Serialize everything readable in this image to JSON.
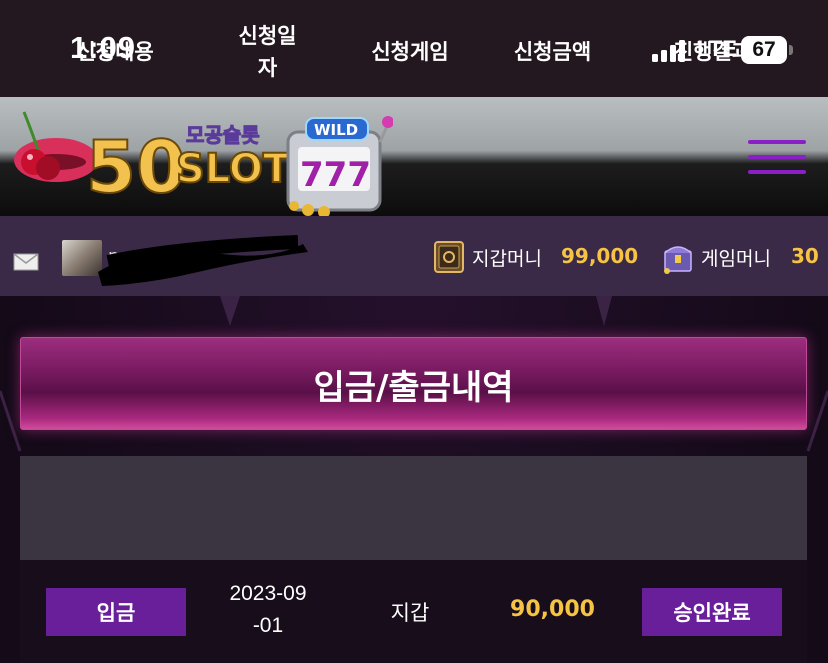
{
  "status_bar": {
    "time": "1:09",
    "network": "LTE",
    "battery": "67"
  },
  "header": {
    "logo_text_top": "모공슬롯",
    "logo_number": "50",
    "logo_word": "SLOT",
    "logo_badge": "WILD",
    "logo_reels": "777"
  },
  "user_bar": {
    "username": "n",
    "wallet_label": "지갑머니",
    "wallet_value": "99,000",
    "game_label": "게임머니",
    "game_value": "30"
  },
  "page": {
    "title": "입금/출금내역"
  },
  "table": {
    "headers": [
      "신청내용",
      "신청일자",
      "신청게임",
      "신청금액",
      "진행결과"
    ],
    "rows": [
      {
        "type": "입금",
        "date": "2023-09-01",
        "game": "지갑",
        "amount": "90,000",
        "status": "승인완료"
      }
    ]
  },
  "colors": {
    "accent_purple": "#6a1f9a",
    "gold": "#f6c343",
    "banner_pink": "#9c2e7e"
  }
}
